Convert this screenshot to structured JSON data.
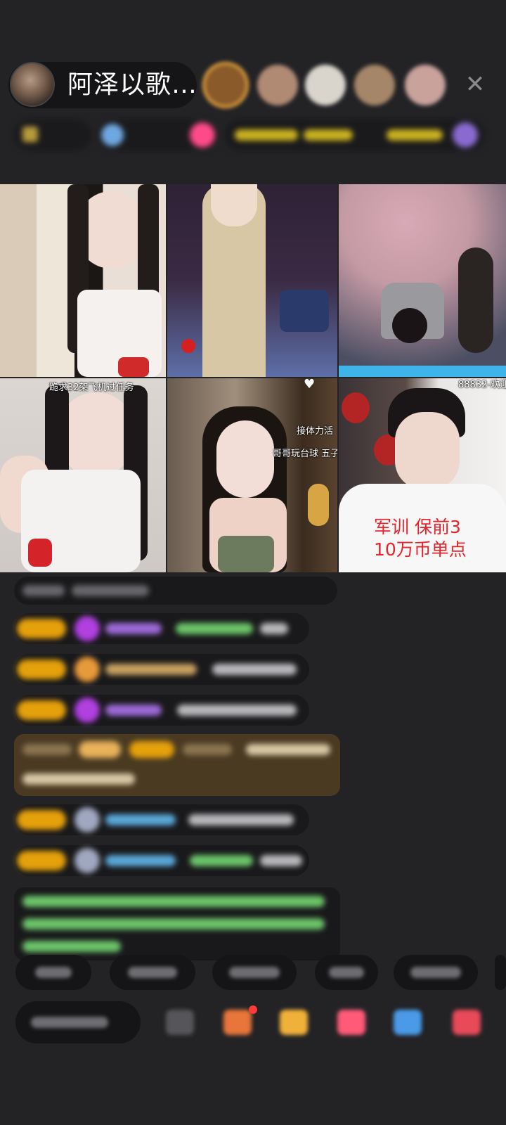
{
  "header": {
    "host_name": "阿泽以歌…",
    "close_glyph": "✕"
  },
  "grid": {
    "tiles": [
      {
        "caption": ""
      },
      {
        "caption": ""
      },
      {
        "caption": ""
      },
      {
        "caption": "跪求32架飞机过任务"
      },
      {
        "caption_top": "接体力活",
        "caption_bottom": "哥哥玩台球 五子",
        "heart": "♥"
      },
      {
        "caption": "88832-欢迎",
        "promo_line1": "军训 保前3",
        "promo_line2": "10万币单点"
      }
    ]
  },
  "colors": {
    "background": "#232326",
    "badge": "#e5a10c",
    "promo_text": "#e8222a"
  }
}
